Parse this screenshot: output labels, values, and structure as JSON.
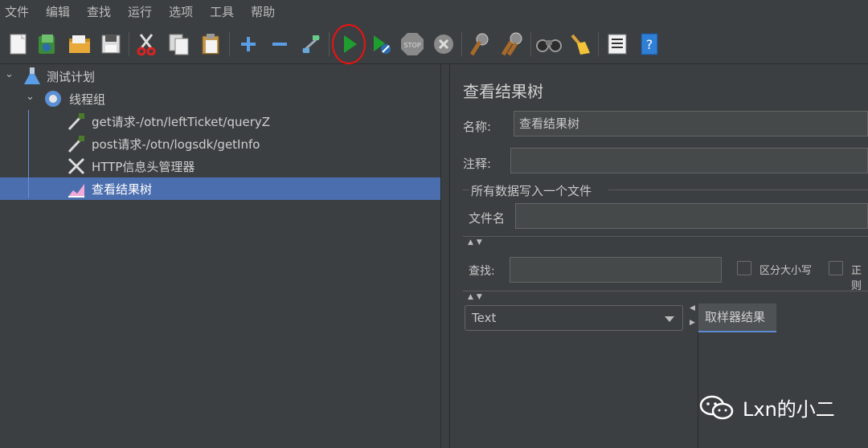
{
  "menu": [
    "文件",
    "编辑",
    "查找",
    "运行",
    "选项",
    "工具",
    "帮助"
  ],
  "toolbar_icons": [
    "new-icon",
    "templates-icon",
    "open-icon",
    "save-icon",
    "cut-icon",
    "copy-icon",
    "paste-icon",
    "expand-icon",
    "collapse-icon",
    "toggle-icon",
    "start-icon",
    "start-no-pauses-icon",
    "stop-icon",
    "shutdown-icon",
    "clear-icon",
    "clear-all-icon",
    "search-icon",
    "reset-search-icon",
    "function-helper-icon",
    "help-icon"
  ],
  "tree": {
    "test_plan": "测试计划",
    "thread_group": "线程组",
    "sampler1": "get请求-/otn/leftTicket/queryZ",
    "sampler2": "post请求-/otn/logsdk/getInfo",
    "header_manager": "HTTP信息头管理器",
    "result_tree": "查看结果树"
  },
  "panel": {
    "title": "查看结果树",
    "name_label": "名称:",
    "name_value": "查看结果树",
    "comment_label": "注释:",
    "group_title": "所有数据写入一个文件",
    "filename_label": "文件名",
    "search_label": "查找:",
    "case_sensitive": "区分大小写",
    "regex": "正则",
    "renderer": "Text",
    "tab_label": "取样器结果"
  },
  "watermark": "Lxn的小二",
  "colors": {
    "selection": "#4b6eaf",
    "play": "#1e9e2e",
    "highlight_ring": "#ee1111"
  }
}
